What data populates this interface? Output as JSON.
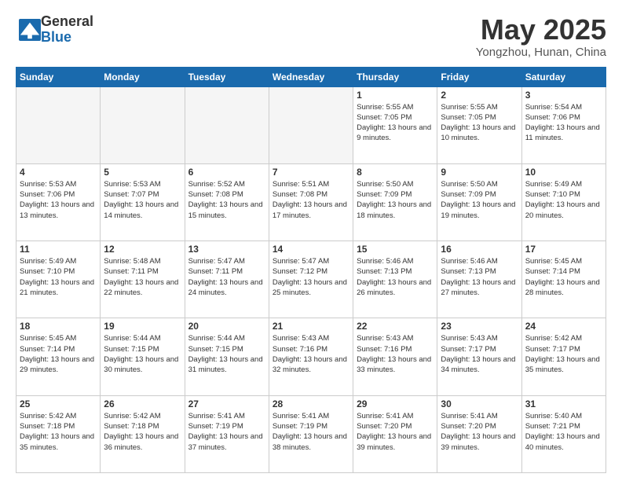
{
  "logo": {
    "general": "General",
    "blue": "Blue"
  },
  "title": "May 2025",
  "location": "Yongzhou, Hunan, China",
  "days_of_week": [
    "Sunday",
    "Monday",
    "Tuesday",
    "Wednesday",
    "Thursday",
    "Friday",
    "Saturday"
  ],
  "weeks": [
    [
      {
        "day": "",
        "empty": true
      },
      {
        "day": "",
        "empty": true
      },
      {
        "day": "",
        "empty": true
      },
      {
        "day": "",
        "empty": true
      },
      {
        "day": "1",
        "sunrise": "5:55 AM",
        "sunset": "7:05 PM",
        "daylight": "13 hours and 9 minutes."
      },
      {
        "day": "2",
        "sunrise": "5:55 AM",
        "sunset": "7:05 PM",
        "daylight": "13 hours and 10 minutes."
      },
      {
        "day": "3",
        "sunrise": "5:54 AM",
        "sunset": "7:06 PM",
        "daylight": "13 hours and 11 minutes."
      }
    ],
    [
      {
        "day": "4",
        "sunrise": "5:53 AM",
        "sunset": "7:06 PM",
        "daylight": "13 hours and 13 minutes."
      },
      {
        "day": "5",
        "sunrise": "5:53 AM",
        "sunset": "7:07 PM",
        "daylight": "13 hours and 14 minutes."
      },
      {
        "day": "6",
        "sunrise": "5:52 AM",
        "sunset": "7:08 PM",
        "daylight": "13 hours and 15 minutes."
      },
      {
        "day": "7",
        "sunrise": "5:51 AM",
        "sunset": "7:08 PM",
        "daylight": "13 hours and 17 minutes."
      },
      {
        "day": "8",
        "sunrise": "5:50 AM",
        "sunset": "7:09 PM",
        "daylight": "13 hours and 18 minutes."
      },
      {
        "day": "9",
        "sunrise": "5:50 AM",
        "sunset": "7:09 PM",
        "daylight": "13 hours and 19 minutes."
      },
      {
        "day": "10",
        "sunrise": "5:49 AM",
        "sunset": "7:10 PM",
        "daylight": "13 hours and 20 minutes."
      }
    ],
    [
      {
        "day": "11",
        "sunrise": "5:49 AM",
        "sunset": "7:10 PM",
        "daylight": "13 hours and 21 minutes."
      },
      {
        "day": "12",
        "sunrise": "5:48 AM",
        "sunset": "7:11 PM",
        "daylight": "13 hours and 22 minutes."
      },
      {
        "day": "13",
        "sunrise": "5:47 AM",
        "sunset": "7:11 PM",
        "daylight": "13 hours and 24 minutes."
      },
      {
        "day": "14",
        "sunrise": "5:47 AM",
        "sunset": "7:12 PM",
        "daylight": "13 hours and 25 minutes."
      },
      {
        "day": "15",
        "sunrise": "5:46 AM",
        "sunset": "7:13 PM",
        "daylight": "13 hours and 26 minutes."
      },
      {
        "day": "16",
        "sunrise": "5:46 AM",
        "sunset": "7:13 PM",
        "daylight": "13 hours and 27 minutes."
      },
      {
        "day": "17",
        "sunrise": "5:45 AM",
        "sunset": "7:14 PM",
        "daylight": "13 hours and 28 minutes."
      }
    ],
    [
      {
        "day": "18",
        "sunrise": "5:45 AM",
        "sunset": "7:14 PM",
        "daylight": "13 hours and 29 minutes."
      },
      {
        "day": "19",
        "sunrise": "5:44 AM",
        "sunset": "7:15 PM",
        "daylight": "13 hours and 30 minutes."
      },
      {
        "day": "20",
        "sunrise": "5:44 AM",
        "sunset": "7:15 PM",
        "daylight": "13 hours and 31 minutes."
      },
      {
        "day": "21",
        "sunrise": "5:43 AM",
        "sunset": "7:16 PM",
        "daylight": "13 hours and 32 minutes."
      },
      {
        "day": "22",
        "sunrise": "5:43 AM",
        "sunset": "7:16 PM",
        "daylight": "13 hours and 33 minutes."
      },
      {
        "day": "23",
        "sunrise": "5:43 AM",
        "sunset": "7:17 PM",
        "daylight": "13 hours and 34 minutes."
      },
      {
        "day": "24",
        "sunrise": "5:42 AM",
        "sunset": "7:17 PM",
        "daylight": "13 hours and 35 minutes."
      }
    ],
    [
      {
        "day": "25",
        "sunrise": "5:42 AM",
        "sunset": "7:18 PM",
        "daylight": "13 hours and 35 minutes."
      },
      {
        "day": "26",
        "sunrise": "5:42 AM",
        "sunset": "7:18 PM",
        "daylight": "13 hours and 36 minutes."
      },
      {
        "day": "27",
        "sunrise": "5:41 AM",
        "sunset": "7:19 PM",
        "daylight": "13 hours and 37 minutes."
      },
      {
        "day": "28",
        "sunrise": "5:41 AM",
        "sunset": "7:19 PM",
        "daylight": "13 hours and 38 minutes."
      },
      {
        "day": "29",
        "sunrise": "5:41 AM",
        "sunset": "7:20 PM",
        "daylight": "13 hours and 39 minutes."
      },
      {
        "day": "30",
        "sunrise": "5:41 AM",
        "sunset": "7:20 PM",
        "daylight": "13 hours and 39 minutes."
      },
      {
        "day": "31",
        "sunrise": "5:40 AM",
        "sunset": "7:21 PM",
        "daylight": "13 hours and 40 minutes."
      }
    ]
  ]
}
